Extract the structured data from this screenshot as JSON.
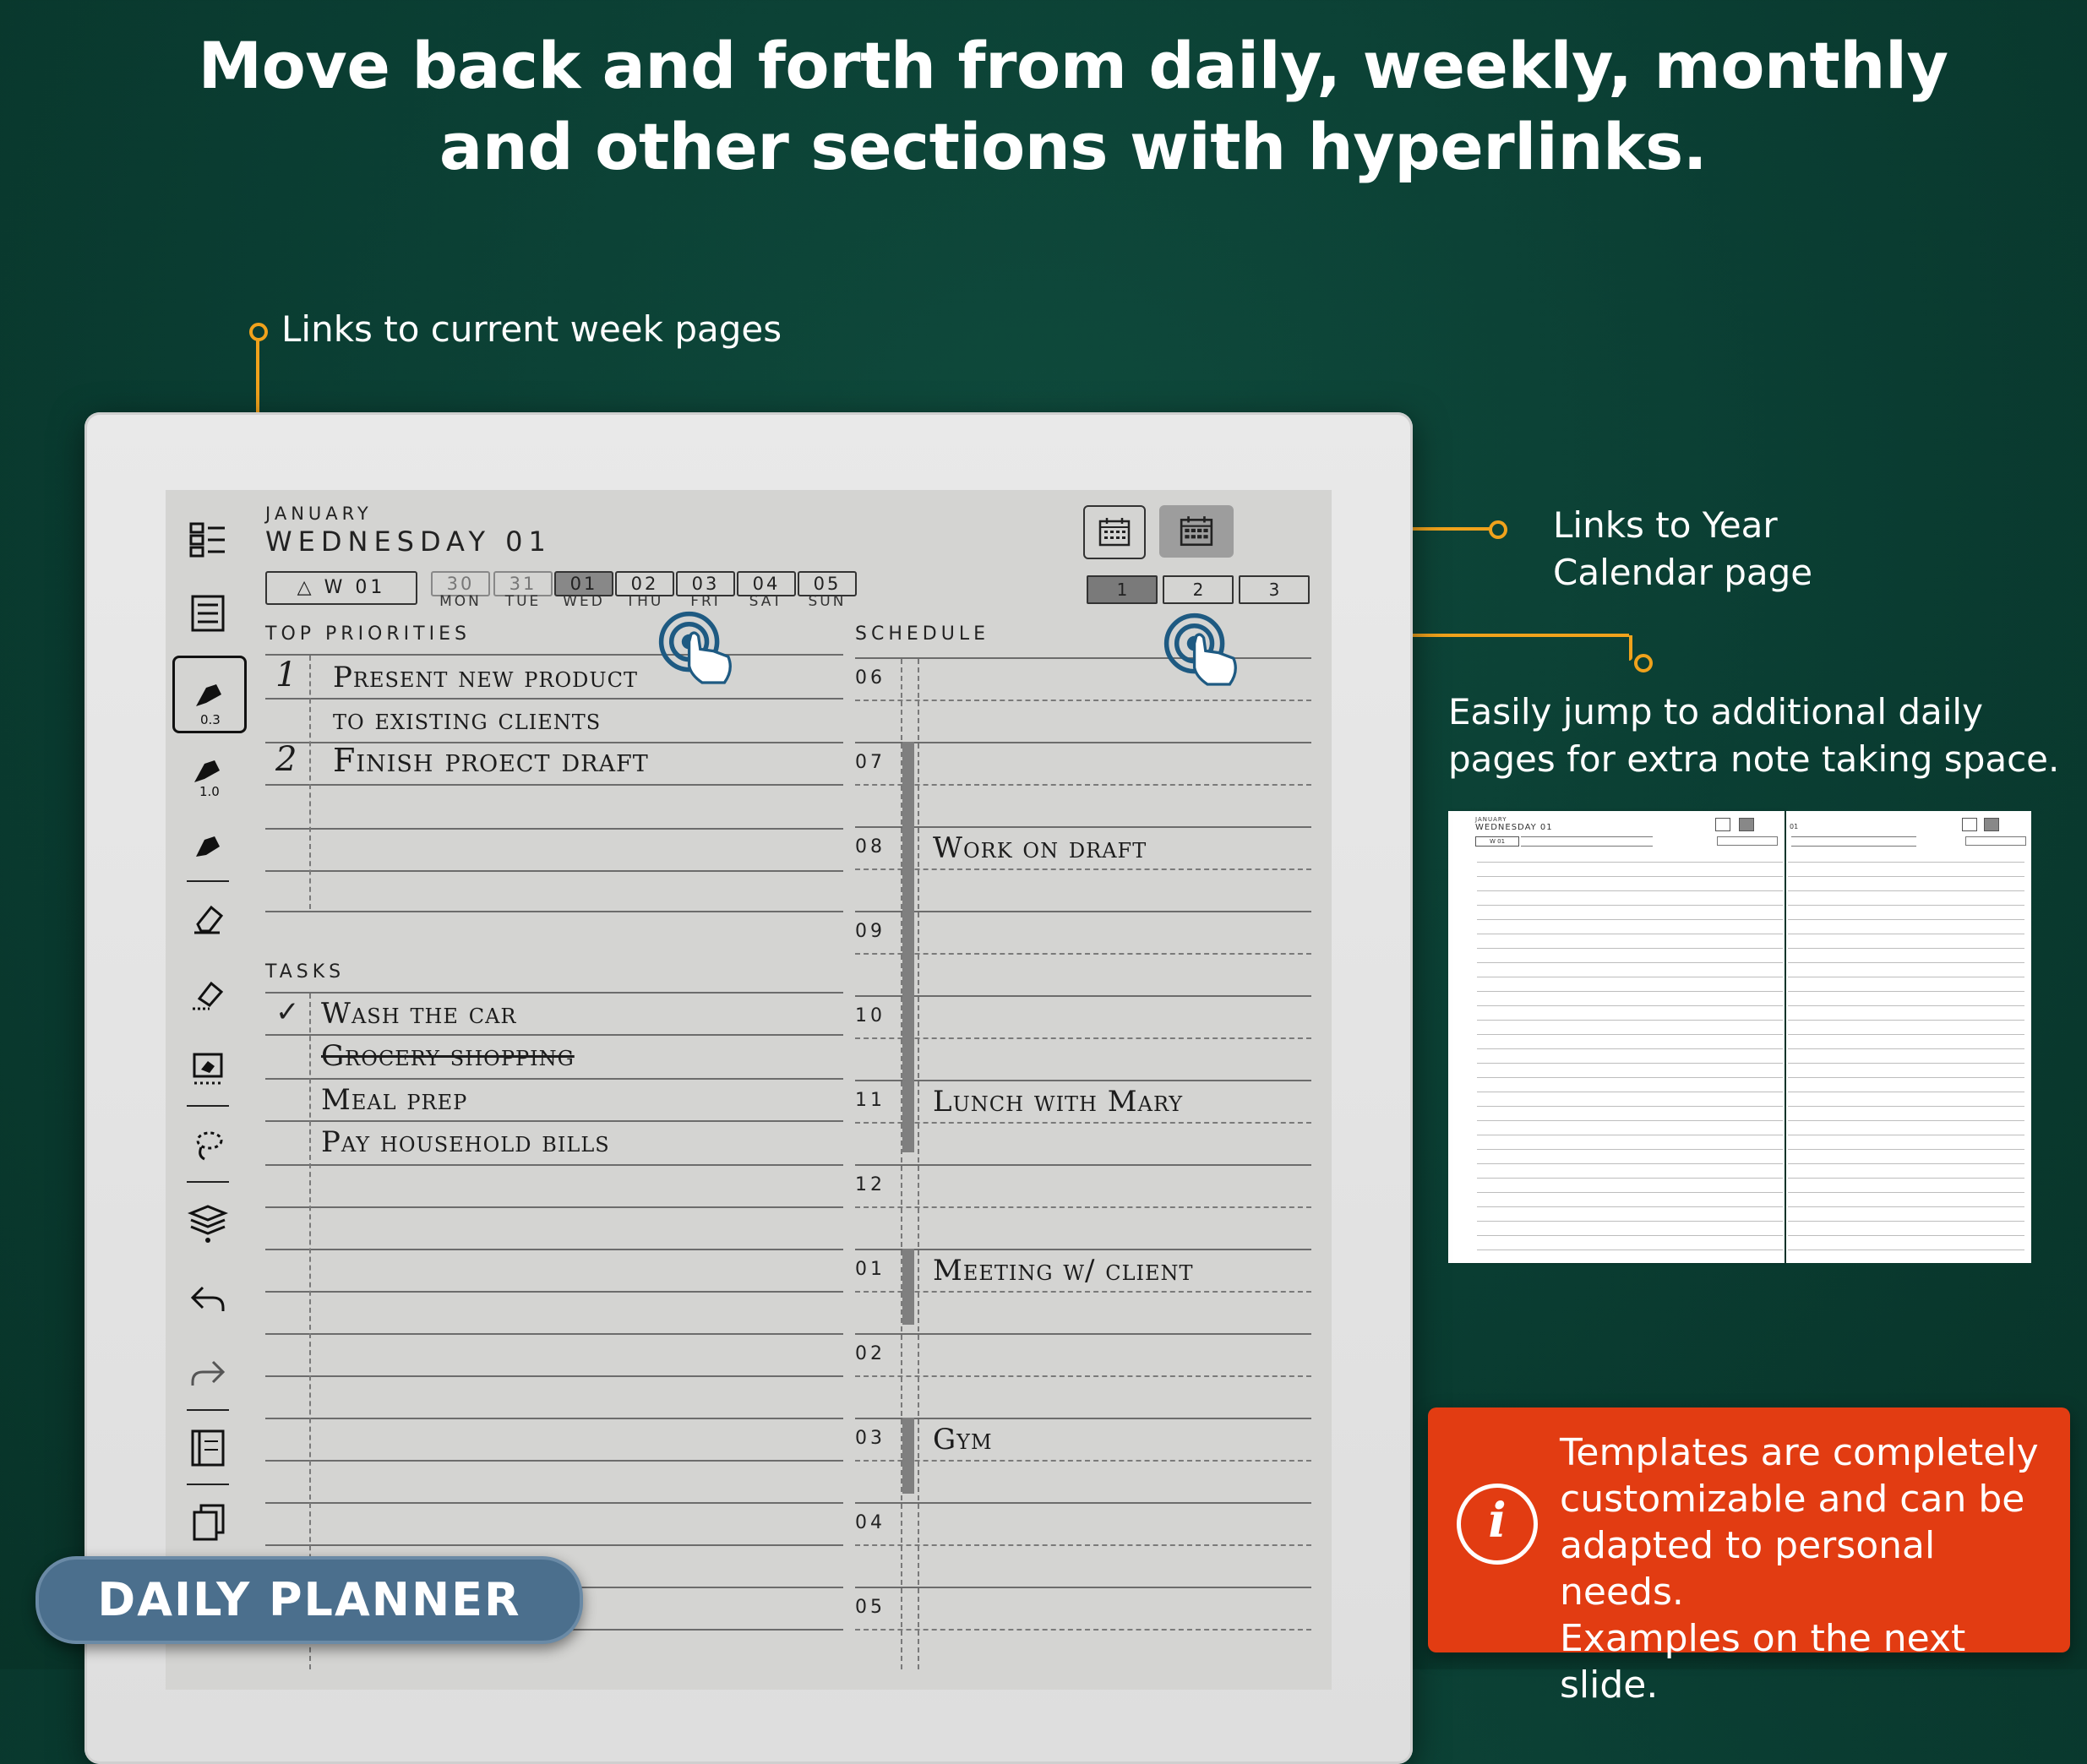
{
  "headline": {
    "line1": "Move back and forth from daily, weekly, monthly",
    "line2": "and other sections with hyperlinks."
  },
  "callouts": {
    "week": "Links to current week pages",
    "year_line1": "Links to Year",
    "year_line2": "Calendar page",
    "daily_line1": "Easily jump to additional daily",
    "daily_line2": "pages for extra note taking space."
  },
  "info_box": {
    "icon": "info-icon",
    "lines": [
      "Templates are completely",
      "customizable and can be",
      "adapted to personal needs.",
      "Examples on the next slide."
    ]
  },
  "badge": "DAILY PLANNER",
  "planner": {
    "month": "JANUARY",
    "day_title": "WEDNESDAY 01",
    "week_button": "W 01",
    "days": [
      {
        "num": "30",
        "label": "MON"
      },
      {
        "num": "31",
        "label": "TUE"
      },
      {
        "num": "01",
        "label": "WED"
      },
      {
        "num": "02",
        "label": "THU"
      },
      {
        "num": "03",
        "label": "FRI"
      },
      {
        "num": "04",
        "label": "SAT"
      },
      {
        "num": "05",
        "label": "SUN"
      }
    ],
    "pages": [
      "1",
      "2",
      "3"
    ],
    "top_priorities_label": "TOP PRIORITIES",
    "priorities": [
      {
        "num": "1",
        "line1": "Present new product",
        "line2": "to existing clients"
      },
      {
        "num": "2",
        "line1": "Finish proect draft"
      }
    ],
    "tasks_label": "TASKS",
    "tasks": [
      {
        "check": "✓",
        "text": "Wash the car"
      },
      {
        "check": "",
        "text": "Grocery shopping"
      },
      {
        "check": "",
        "text": "Meal prep"
      },
      {
        "check": "",
        "text": "Pay household bills"
      }
    ],
    "schedule_label": "SCHEDULE",
    "hours": [
      "06",
      "07",
      "08",
      "09",
      "10",
      "11",
      "12",
      "01",
      "02",
      "03",
      "04",
      "05"
    ],
    "schedule_entries": {
      "08": "Work on draft",
      "11": "Lunch with Mary",
      "01": "Meeting w/ client",
      "03": "Gym"
    }
  },
  "toolbar": {
    "pen_size_1": "0.3",
    "pen_size_2": "1.0"
  },
  "thumbnail": {
    "month": "JANUARY",
    "title": "WEDNESDAY 01",
    "week": "W 01",
    "day2": "01"
  },
  "colors": {
    "background": "#0a3d32",
    "accent": "#f0a21c",
    "info_box": "#e23c12",
    "badge": "#4b6f8d"
  }
}
